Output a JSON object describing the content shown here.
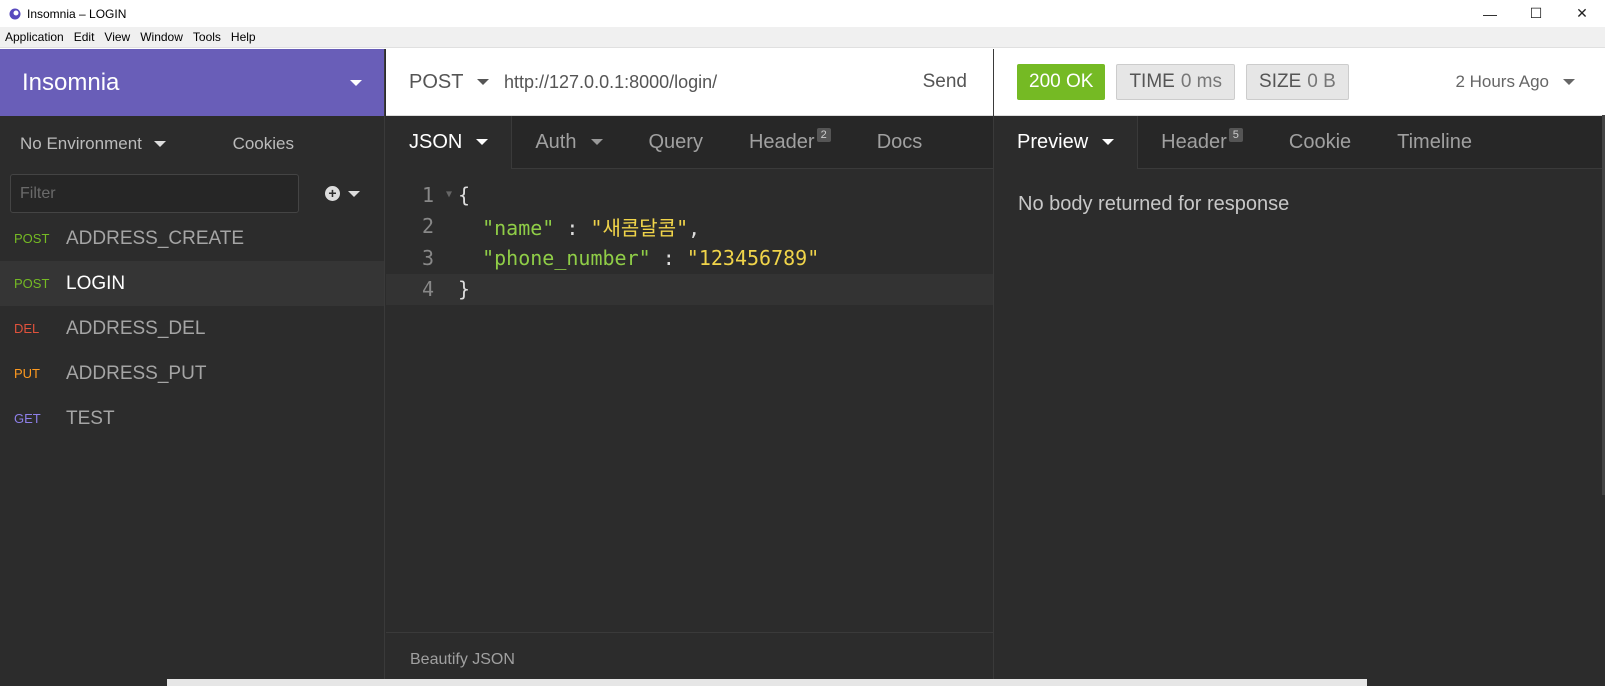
{
  "window": {
    "title": "Insomnia – LOGIN",
    "controls": [
      "—",
      "☐",
      "✕"
    ]
  },
  "menu": [
    "Application",
    "Edit",
    "View",
    "Window",
    "Tools",
    "Help"
  ],
  "sidebar": {
    "workspace": "Insomnia",
    "environment": "No Environment",
    "cookies": "Cookies",
    "filter_placeholder": "Filter",
    "requests": [
      {
        "method": "POST",
        "name": "ADDRESS_CREATE"
      },
      {
        "method": "POST",
        "name": "LOGIN"
      },
      {
        "method": "DEL",
        "name": "ADDRESS_DEL"
      },
      {
        "method": "PUT",
        "name": "ADDRESS_PUT"
      },
      {
        "method": "GET",
        "name": "TEST"
      }
    ]
  },
  "request": {
    "method": "POST",
    "url": "http://127.0.0.1:8000/login/",
    "send": "Send",
    "tabs": {
      "body": "JSON",
      "auth": "Auth",
      "query": "Query",
      "header": "Header",
      "header_count": "2",
      "docs": "Docs"
    },
    "body_lines": {
      "n1": "1",
      "n2": "2",
      "n3": "3",
      "n4": "4",
      "open": "{",
      "key1": "\"name\"",
      "sep1": " : ",
      "val1": "\"새콤달콤\"",
      "comma": ",",
      "key2": "\"phone_number\"",
      "sep2": " : ",
      "val2": "\"123456789\"",
      "close": "}"
    },
    "footer": "Beautify JSON"
  },
  "response": {
    "status": "200 OK",
    "time_label": "TIME",
    "time_value": "0 ms",
    "size_label": "SIZE",
    "size_value": "0 B",
    "time_ago": "2 Hours Ago",
    "tabs": {
      "preview": "Preview",
      "header": "Header",
      "header_count": "5",
      "cookie": "Cookie",
      "timeline": "Timeline"
    },
    "body": "No body returned for response"
  }
}
